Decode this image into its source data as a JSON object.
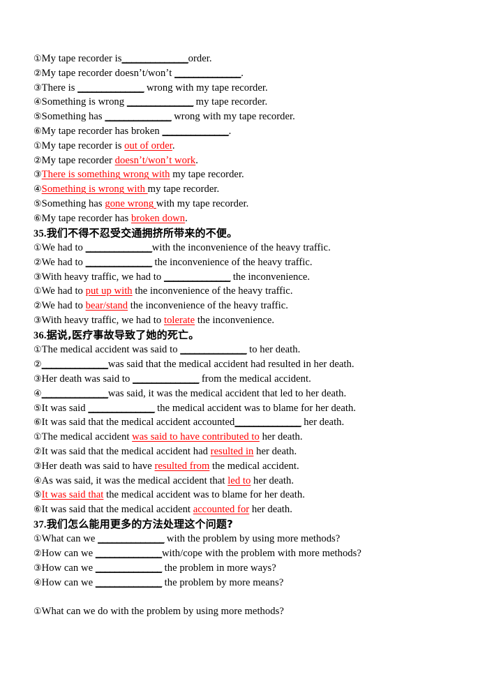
{
  "document": {
    "type": "grammar-exercise-worksheet",
    "language_mix": "chinese-english",
    "accent_color_red": "#ff0000",
    "text_color": "#000000",
    "background": "#ffffff",
    "blank_glyph": "______________"
  },
  "blocks": [
    {
      "kind": "question-group",
      "id": "q34-prompts",
      "lines": [
        {
          "marker": "①",
          "style": "prompt",
          "segments": [
            {
              "t": "My tape recorder is",
              "c": "black"
            },
            {
              "t": "______________",
              "c": "blank"
            },
            {
              "t": "order.",
              "c": "black"
            }
          ]
        },
        {
          "marker": "②",
          "style": "prompt",
          "segments": [
            {
              "t": "My tape recorder doesnʼt/wonʼt ",
              "c": "black"
            },
            {
              "t": "______________",
              "c": "blank"
            },
            {
              "t": ".",
              "c": "black"
            }
          ]
        },
        {
          "marker": "③",
          "style": "prompt",
          "segments": [
            {
              "t": "There is ",
              "c": "black"
            },
            {
              "t": "______________",
              "c": "blank"
            },
            {
              "t": " wrong with my tape recorder.",
              "c": "black"
            }
          ]
        },
        {
          "marker": "④",
          "style": "prompt",
          "segments": [
            {
              "t": "Something is wrong ",
              "c": "black"
            },
            {
              "t": "______________",
              "c": "blank"
            },
            {
              "t": " my tape recorder.",
              "c": "black"
            }
          ]
        },
        {
          "marker": "⑤",
          "style": "prompt",
          "segments": [
            {
              "t": "Something has ",
              "c": "black"
            },
            {
              "t": "______________",
              "c": "blank"
            },
            {
              "t": " wrong with my tape recorder.",
              "c": "black"
            }
          ]
        },
        {
          "marker": "⑥",
          "style": "prompt",
          "segments": [
            {
              "t": "My tape recorder has broken ",
              "c": "black"
            },
            {
              "t": "______________",
              "c": "blank"
            },
            {
              "t": ".",
              "c": "black"
            }
          ]
        }
      ]
    },
    {
      "kind": "answer-group",
      "id": "q34-answers",
      "lines": [
        {
          "marker": "①",
          "style": "answer",
          "segments": [
            {
              "t": "My tape recorder is ",
              "c": "black"
            },
            {
              "t": "out of order",
              "c": "red-underline"
            },
            {
              "t": ".",
              "c": "black"
            }
          ]
        },
        {
          "marker": "②",
          "style": "answer",
          "segments": [
            {
              "t": "My tape recorder ",
              "c": "black"
            },
            {
              "t": "doesnʼt/wonʼt work",
              "c": "red-underline"
            },
            {
              "t": ".",
              "c": "black"
            }
          ]
        },
        {
          "marker": "③",
          "style": "answer",
          "segments": [
            {
              "t": "There is something wrong with",
              "c": "red-underline"
            },
            {
              "t": " my tape recorder.",
              "c": "black"
            }
          ]
        },
        {
          "marker": "④",
          "style": "answer",
          "segments": [
            {
              "t": "Something is wrong with ",
              "c": "red-underline"
            },
            {
              "t": "my tape recorder.",
              "c": "black"
            }
          ]
        },
        {
          "marker": "⑤",
          "style": "answer",
          "segments": [
            {
              "t": "Something has ",
              "c": "black"
            },
            {
              "t": "gone wrong ",
              "c": "red-underline"
            },
            {
              "t": "with my tape recorder.",
              "c": "black"
            }
          ]
        },
        {
          "marker": "⑥",
          "style": "answer",
          "segments": [
            {
              "t": "My tape recorder has ",
              "c": "black"
            },
            {
              "t": "broken down",
              "c": "red-underline"
            },
            {
              "t": ".",
              "c": "black"
            }
          ]
        }
      ]
    },
    {
      "kind": "heading",
      "id": "heading-35",
      "index": "35.",
      "chinese": "我们不得不忍受交通拥挤所带来的不便。"
    },
    {
      "kind": "question-group",
      "id": "q35-prompts",
      "lines": [
        {
          "marker": "①",
          "style": "prompt",
          "segments": [
            {
              "t": "We had to ",
              "c": "black"
            },
            {
              "t": "______________",
              "c": "blank"
            },
            {
              "t": "with the inconvenience of the heavy traffic.",
              "c": "black"
            }
          ]
        },
        {
          "marker": "②",
          "style": "prompt",
          "segments": [
            {
              "t": "We had to ",
              "c": "black"
            },
            {
              "t": "______________",
              "c": "blank"
            },
            {
              "t": " the inconvenience of the heavy traffic.",
              "c": "black"
            }
          ]
        },
        {
          "marker": "③",
          "style": "prompt",
          "segments": [
            {
              "t": "With heavy traffic, we had to ",
              "c": "black"
            },
            {
              "t": "______________",
              "c": "blank"
            },
            {
              "t": " the inconvenience.",
              "c": "black"
            }
          ]
        }
      ]
    },
    {
      "kind": "answer-group",
      "id": "q35-answers",
      "lines": [
        {
          "marker": "①",
          "style": "answer",
          "segments": [
            {
              "t": "We had to ",
              "c": "black"
            },
            {
              "t": "put up with",
              "c": "red-underline"
            },
            {
              "t": " the inconvenience of the heavy traffic.",
              "c": "black"
            }
          ]
        },
        {
          "marker": "②",
          "style": "answer",
          "segments": [
            {
              "t": "We had to ",
              "c": "black"
            },
            {
              "t": "bear/stand",
              "c": "red-underline"
            },
            {
              "t": " the inconvenience of the heavy traffic.",
              "c": "black"
            }
          ]
        },
        {
          "marker": "③",
          "style": "answer",
          "segments": [
            {
              "t": "With heavy traffic, we had to ",
              "c": "black"
            },
            {
              "t": "tolerate",
              "c": "red-underline"
            },
            {
              "t": " the inconvenience.",
              "c": "black"
            }
          ]
        }
      ]
    },
    {
      "kind": "heading",
      "id": "heading-36",
      "index": "36.",
      "chinese": "据说,医疗事故导致了她的死亡。"
    },
    {
      "kind": "question-group",
      "id": "q36-prompts",
      "lines": [
        {
          "marker": "①",
          "style": "prompt",
          "segments": [
            {
              "t": "The medical accident was said to ",
              "c": "black"
            },
            {
              "t": "______________",
              "c": "blank"
            },
            {
              "t": " to her death.",
              "c": "black"
            }
          ]
        },
        {
          "marker": "②",
          "style": "prompt",
          "segments": [
            {
              "t": "______________",
              "c": "blank"
            },
            {
              "t": "was said that the medical accident had resulted in her death.",
              "c": "black"
            }
          ]
        },
        {
          "marker": "③",
          "style": "prompt",
          "segments": [
            {
              "t": "Her death was said to ",
              "c": "black"
            },
            {
              "t": "______________",
              "c": "blank"
            },
            {
              "t": " from the medical accident.",
              "c": "black"
            }
          ]
        },
        {
          "marker": "④",
          "style": "prompt",
          "segments": [
            {
              "t": "______________",
              "c": "blank"
            },
            {
              "t": "was said, it was the medical accident that led to her death.",
              "c": "black"
            }
          ]
        },
        {
          "marker": "⑤",
          "style": "prompt",
          "segments": [
            {
              "t": "It was said ",
              "c": "black"
            },
            {
              "t": "______________",
              "c": "blank"
            },
            {
              "t": " the medical accident was to blame for her death.",
              "c": "black"
            }
          ]
        },
        {
          "marker": "⑥",
          "style": "prompt",
          "segments": [
            {
              "t": "It was said that the medical accident accounted",
              "c": "black"
            },
            {
              "t": "______________",
              "c": "blank"
            },
            {
              "t": " her death.",
              "c": "black"
            }
          ]
        }
      ]
    },
    {
      "kind": "answer-group",
      "id": "q36-answers",
      "lines": [
        {
          "marker": "①",
          "style": "answer",
          "segments": [
            {
              "t": "The medical accident ",
              "c": "black"
            },
            {
              "t": "was said to have contributed to",
              "c": "red-underline"
            },
            {
              "t": " her death.",
              "c": "black"
            }
          ]
        },
        {
          "marker": "②",
          "style": "answer",
          "segments": [
            {
              "t": "It was said that the medical accident had ",
              "c": "black"
            },
            {
              "t": "resulted in",
              "c": "red-underline"
            },
            {
              "t": " her death.",
              "c": "black"
            }
          ]
        },
        {
          "marker": "③",
          "style": "answer",
          "segments": [
            {
              "t": "Her death was said to have ",
              "c": "black"
            },
            {
              "t": "resulted from",
              "c": "red-underline"
            },
            {
              "t": " the medical accident.",
              "c": "black"
            }
          ]
        },
        {
          "marker": "④",
          "style": "answer",
          "segments": [
            {
              "t": "As was said, it was the medical accident that ",
              "c": "black"
            },
            {
              "t": "led to",
              "c": "red-underline"
            },
            {
              "t": " her death.",
              "c": "black"
            }
          ]
        },
        {
          "marker": "⑤",
          "style": "answer",
          "segments": [
            {
              "t": "It was said that",
              "c": "red-underline"
            },
            {
              "t": " the medical accident was to blame for her death.",
              "c": "black"
            }
          ]
        },
        {
          "marker": "⑥",
          "style": "answer",
          "segments": [
            {
              "t": "It was said that the medical accident ",
              "c": "black"
            },
            {
              "t": "accounted for",
              "c": "red-underline"
            },
            {
              "t": " her death.",
              "c": "black"
            }
          ]
        }
      ]
    },
    {
      "kind": "heading",
      "id": "heading-37",
      "index": "37.",
      "chinese": "我们怎么能用更多的方法处理这个问题?"
    },
    {
      "kind": "question-group",
      "id": "q37-prompts",
      "lines": [
        {
          "marker": "①",
          "style": "prompt",
          "segments": [
            {
              "t": "What can we ",
              "c": "black"
            },
            {
              "t": "______________",
              "c": "blank"
            },
            {
              "t": " with the problem by using more methods?",
              "c": "black"
            }
          ]
        },
        {
          "marker": "②",
          "style": "prompt",
          "segments": [
            {
              "t": "How can we ",
              "c": "black"
            },
            {
              "t": "______________",
              "c": "blank"
            },
            {
              "t": "with/cope with the problem with more methods?",
              "c": "black"
            }
          ]
        },
        {
          "marker": "③",
          "style": "prompt",
          "segments": [
            {
              "t": "How can we ",
              "c": "black"
            },
            {
              "t": "______________",
              "c": "blank"
            },
            {
              "t": " the problem in more ways?",
              "c": "black"
            }
          ]
        },
        {
          "marker": "④",
          "style": "prompt",
          "segments": [
            {
              "t": "How can we ",
              "c": "black"
            },
            {
              "t": "______________",
              "c": "blank"
            },
            {
              "t": " the problem by more means?",
              "c": "black"
            }
          ]
        }
      ]
    },
    {
      "kind": "spacer",
      "id": "gap-before-q37-answers"
    },
    {
      "kind": "answer-group",
      "id": "q37-answers",
      "lines": [
        {
          "marker": "①",
          "style": "answer",
          "segments": [
            {
              "t": "What can we do with the problem by using more methods?",
              "c": "black"
            }
          ]
        }
      ]
    }
  ]
}
